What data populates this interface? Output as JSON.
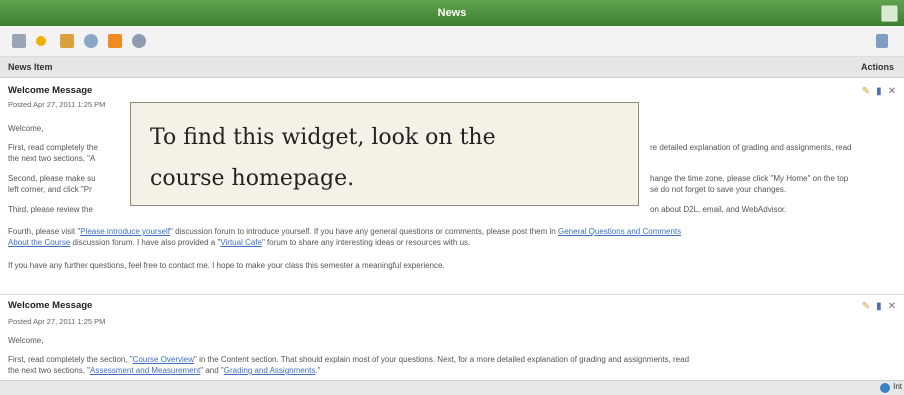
{
  "widget": {
    "title": "News",
    "collapse_icon": "collapse-icon"
  },
  "toolbar": {
    "icons": [
      "grid-icon",
      "add-icon",
      "sort-icon",
      "settings-icon",
      "rss-icon",
      "help-icon",
      "filter-icon"
    ]
  },
  "columns": {
    "news_item": "News Item",
    "actions": "Actions"
  },
  "items": [
    {
      "title": "Welcome Message",
      "posted": "Posted Apr 27, 2011 1:25 PM",
      "greeting": "Welcome,",
      "p1_a": "First, read completely the",
      "p1_b": "re detailed explanation of grading and assignments, read",
      "p1_c": "the next two sections, \"A",
      "p2_a": "Second, please make su",
      "p2_b": "hange the time zone, please click \"My Home\" on the top",
      "p2_c": "left corner, and click \"Pr",
      "p2_d": "se do not forget to save your changes.",
      "p3_a": "Third, please review the",
      "p3_b": "on about D2L, email, and WebAdvisor.",
      "p4_a": "Fourth, please visit \"",
      "p4_link": "Please introduce yourself",
      "p4_b": "\" discussion forum to introduce yourself. If you have any general questions or comments, please post them in",
      "p4_link2": "General Questions and Comments",
      "p4_link3": "About the Course",
      "p4_c": "discussion forum. I have also provided a \"",
      "p4_link4": "Virtual Cafe",
      "p4_d": "\" forum to share any interesting ideas or resources with us.",
      "p5": "If you have any further questions, feel free to contact me. I hope to make your class this semester a meaningful experience."
    },
    {
      "title": "Welcome Message",
      "posted": "Posted Apr 27, 2011 1:25 PM",
      "greeting": "Welcome,",
      "p1_a": "First, read completely the section, \"",
      "p1_link": "Course Overview",
      "p1_b": "\" in the Content section. That should explain most of your questions. Next, for a more detailed explanation of grading and assignments, read",
      "p1_c": "the next two sections, \"",
      "p1_link2": "Assessment and Measurement",
      "p1_d": "\" and \"",
      "p1_link3": "Grading and Assignments",
      "p1_e": ".\""
    }
  ],
  "overlay": {
    "line1": "To find this widget, look on the",
    "line2": "course homepage."
  },
  "statusbar": {
    "text": "Int"
  }
}
